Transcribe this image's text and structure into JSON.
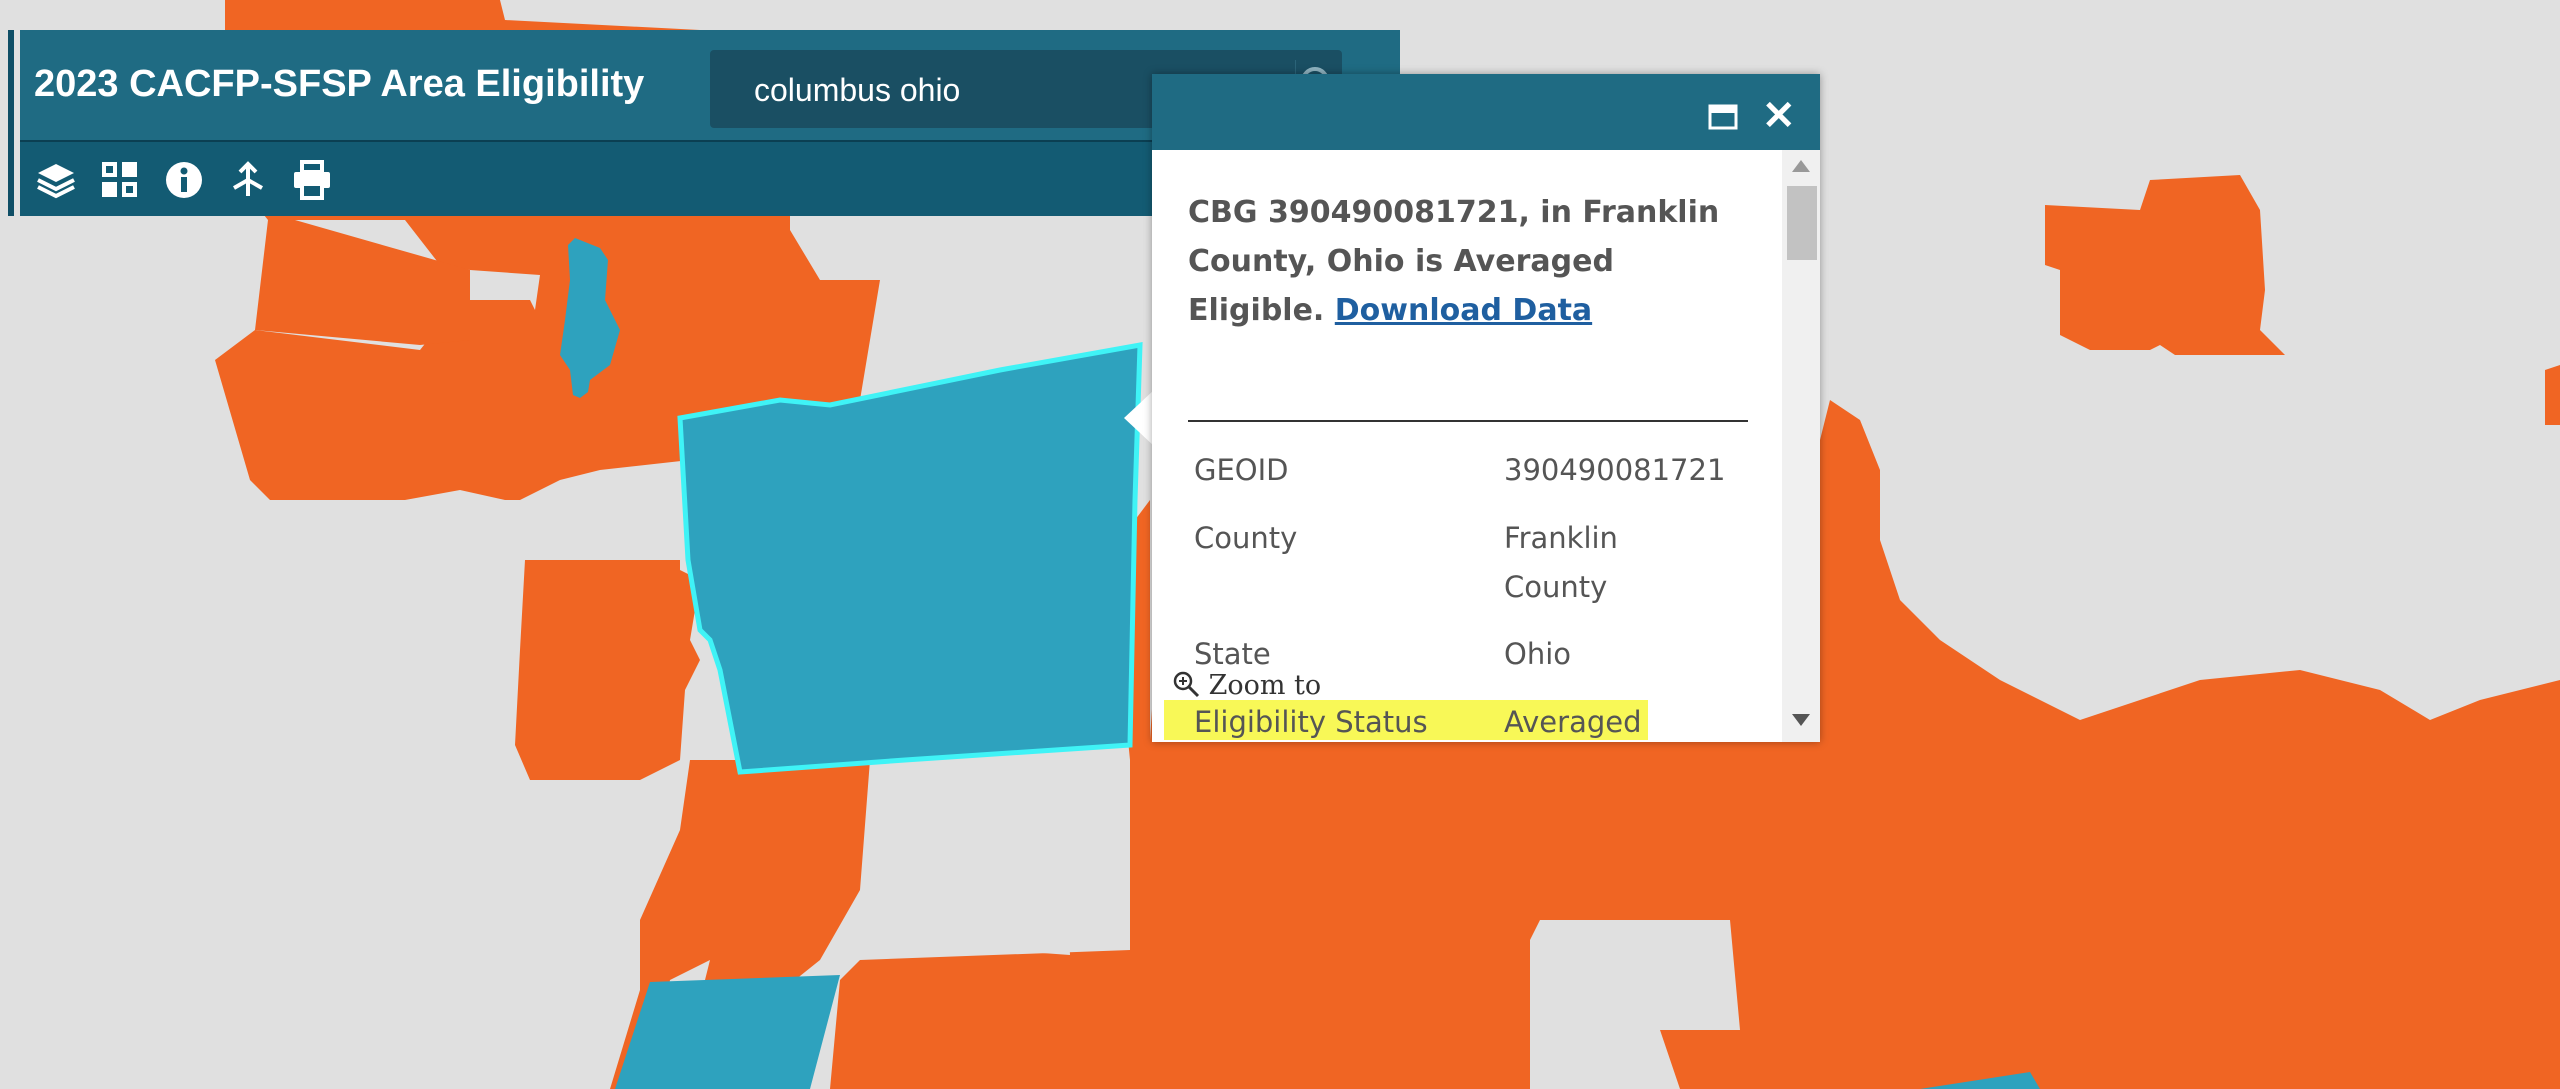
{
  "app": {
    "title": "2023 CACFP-SFSP Area Eligibility",
    "search": {
      "value": "columbus ohio"
    },
    "toolbar_icons": [
      "layers-icon",
      "basemap-gallery-icon",
      "info-icon",
      "share-icon",
      "print-icon"
    ]
  },
  "map": {
    "colors": {
      "background": "#e0e0e0",
      "eligible": "#f06523",
      "averaged": "#2ea2be",
      "selected_outline": "#3ff3f6"
    }
  },
  "popup": {
    "summary_text": "CBG 390490081721, in Franklin County, Ohio is Averaged Eligible.",
    "download_link": "Download Data",
    "attributes": [
      {
        "label": "GEOID",
        "value": "390490081721"
      },
      {
        "label": "County",
        "value": "Franklin County"
      },
      {
        "label": "State",
        "value": "Ohio"
      },
      {
        "label": "Eligibility Status",
        "value": "Averaged"
      }
    ],
    "zoom_label": "Zoom to",
    "colors": {
      "header": "#1f6b83",
      "highlight": "#f7f73a",
      "link": "#1f5fa0"
    }
  }
}
